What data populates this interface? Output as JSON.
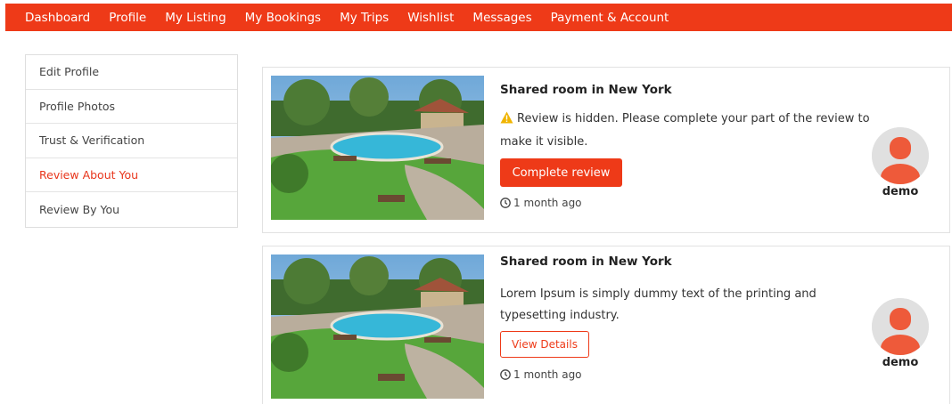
{
  "nav": {
    "items": [
      "Dashboard",
      "Profile",
      "My Listing",
      "My Bookings",
      "My Trips",
      "Wishlist",
      "Messages",
      "Payment & Account"
    ]
  },
  "sidebar": {
    "items": [
      {
        "label": "Edit Profile",
        "active": false
      },
      {
        "label": "Profile Photos",
        "active": false
      },
      {
        "label": "Trust & Verification",
        "active": false
      },
      {
        "label": "Review About You",
        "active": true
      },
      {
        "label": "Review By You",
        "active": false
      }
    ]
  },
  "reviews": [
    {
      "title": "Shared room in New York",
      "message": "Review is hidden. Please complete your part of the review to make it visible.",
      "button_label": "Complete review",
      "time": "1 month ago",
      "reviewer_name": "demo"
    },
    {
      "title": "Shared room in New York",
      "message": "Lorem Ipsum is simply dummy text of the printing and typesetting industry.",
      "button_label": "View Details",
      "time": "1 month ago",
      "reviewer_name": "demo"
    }
  ],
  "colors": {
    "accent": "#ee3a18",
    "warning": "#f0b400"
  },
  "icons": {
    "warning": "warning-triangle-icon",
    "clock": "clock-icon",
    "avatar": "user-avatar-icon"
  }
}
